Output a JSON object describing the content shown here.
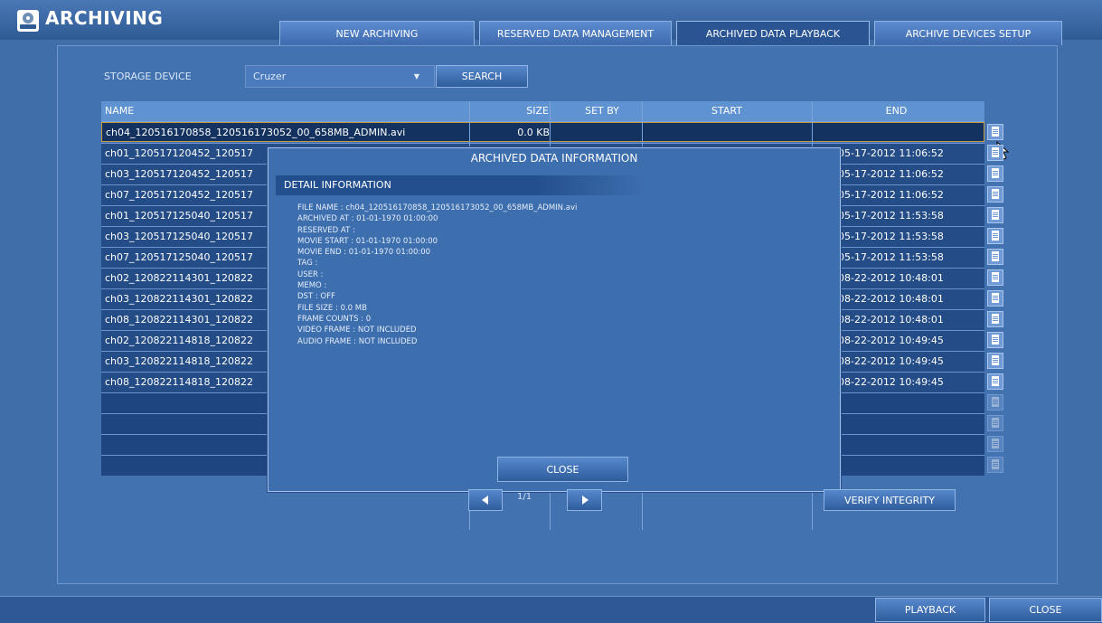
{
  "app": {
    "title": "ARCHIVING",
    "icon": "disc-drive-icon"
  },
  "tabs": [
    {
      "label": "NEW ARCHIVING",
      "active": false
    },
    {
      "label": "RESERVED DATA MANAGEMENT",
      "active": false
    },
    {
      "label": "ARCHIVED DATA PLAYBACK",
      "active": true
    },
    {
      "label": "ARCHIVE DEVICES SETUP",
      "active": false
    }
  ],
  "storage": {
    "label": "STORAGE DEVICE",
    "value": "Cruzer",
    "search_label": "SEARCH"
  },
  "table": {
    "headers": {
      "name": "NAME",
      "size": "SIZE",
      "set_by": "SET BY",
      "start": "START",
      "end": "END"
    },
    "rows": [
      {
        "name": "ch04_120516170858_120516173052_00_658MB_ADMIN.avi",
        "size": "0.0 KB",
        "set_by": "",
        "start": "",
        "end": "",
        "selected": true
      },
      {
        "name": "ch01_120517120452_120517",
        "size": "",
        "set_by": "",
        "start": "",
        "end": "05-17-2012 11:06:52"
      },
      {
        "name": "ch03_120517120452_120517",
        "size": "",
        "set_by": "",
        "start": "",
        "end": "05-17-2012 11:06:52"
      },
      {
        "name": "ch07_120517120452_120517",
        "size": "",
        "set_by": "",
        "start": "",
        "end": "05-17-2012 11:06:52"
      },
      {
        "name": "ch01_120517125040_120517",
        "size": "",
        "set_by": "",
        "start": "",
        "end": "05-17-2012 11:53:58"
      },
      {
        "name": "ch03_120517125040_120517",
        "size": "",
        "set_by": "",
        "start": "",
        "end": "05-17-2012 11:53:58"
      },
      {
        "name": "ch07_120517125040_120517",
        "size": "",
        "set_by": "",
        "start": "",
        "end": "05-17-2012 11:53:58"
      },
      {
        "name": "ch02_120822114301_120822",
        "size": "",
        "set_by": "",
        "start": "",
        "end": "08-22-2012 10:48:01"
      },
      {
        "name": "ch03_120822114301_120822",
        "size": "",
        "set_by": "",
        "start": "",
        "end": "08-22-2012 10:48:01"
      },
      {
        "name": "ch08_120822114301_120822",
        "size": "",
        "set_by": "",
        "start": "",
        "end": "08-22-2012 10:48:01"
      },
      {
        "name": "ch02_120822114818_120822",
        "size": "",
        "set_by": "",
        "start": "",
        "end": "08-22-2012 10:49:45"
      },
      {
        "name": "ch03_120822114818_120822",
        "size": "",
        "set_by": "",
        "start": "",
        "end": "08-22-2012 10:49:45"
      },
      {
        "name": "ch08_120822114818_120822",
        "size": "",
        "set_by": "",
        "start": "",
        "end": "08-22-2012 10:49:45"
      },
      {
        "name": "",
        "size": "",
        "set_by": "",
        "start": "",
        "end": "",
        "empty": true
      },
      {
        "name": "",
        "size": "",
        "set_by": "",
        "start": "",
        "end": "",
        "empty": true
      },
      {
        "name": "",
        "size": "",
        "set_by": "",
        "start": "",
        "end": "",
        "empty": true
      },
      {
        "name": "",
        "size": "",
        "set_by": "",
        "start": "",
        "end": "",
        "empty": true
      }
    ]
  },
  "dialog": {
    "title": "ARCHIVED DATA INFORMATION",
    "section": "DETAIL INFORMATION",
    "lines": [
      "FILE NAME : ch04_120516170858_120516173052_00_658MB_ADMIN.avi",
      "ARCHIVED AT : 01-01-1970  01:00:00",
      "RESERVED AT :",
      "MOVIE START : 01-01-1970  01:00:00",
      "MOVIE END : 01-01-1970  01:00:00",
      "TAG :",
      "USER :",
      "MEMO :",
      "DST : OFF",
      "FILE SIZE : 0.0 MB",
      "FRAME COUNTS : 0",
      "VIDEO FRAME : NOT INCLUDED",
      "AUDIO FRAME : NOT INCLUDED"
    ],
    "close_label": "CLOSE"
  },
  "pager": {
    "text": "1/1"
  },
  "verify_label": "VERIFY INTEGRITY",
  "footer": {
    "playback_label": "PLAYBACK",
    "close_label": "CLOSE"
  },
  "colors": {
    "background": "#3f6ea8",
    "row": "#244c86",
    "selected_border": "#c69a3d",
    "header": "#5f92d1"
  }
}
